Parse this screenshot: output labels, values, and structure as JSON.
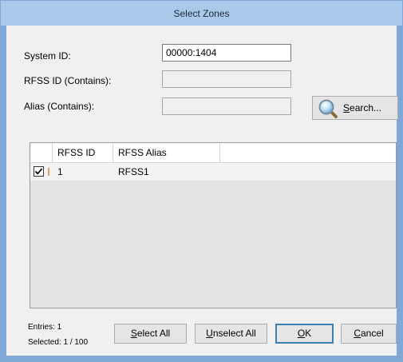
{
  "window": {
    "title": "Select Zones"
  },
  "form": {
    "system_id_label": "System ID:",
    "system_id_value": "00000:1404",
    "rfss_id_label": "RFSS ID (Contains):",
    "rfss_id_value": "",
    "alias_label": "Alias (Contains):",
    "alias_value": "",
    "search_label_underlined": "S",
    "search_label_rest": "earch..."
  },
  "grid": {
    "columns": [
      "RFSS ID",
      "RFSS Alias"
    ],
    "rows": [
      {
        "checked": true,
        "rfss_id": "1",
        "rfss_alias": "RFSS1"
      }
    ]
  },
  "footer": {
    "entries": "Entries: 1",
    "selected": "Selected: 1 / 100",
    "select_all_u": "S",
    "select_all_rest": "elect All",
    "unselect_all_u": "U",
    "unselect_all_rest": "nselect All",
    "ok_u": "O",
    "ok_rest": "K",
    "cancel_u": "C",
    "cancel_rest": "ancel"
  },
  "colors": {
    "window_border": "#7fa8d6",
    "titlebar": "#a9c8ea",
    "client_bg": "#f0f0f0",
    "default_button_border": "#3c7fb1"
  },
  "icons": {
    "search_button_icon": "magnifier-icon",
    "row_check_icon": "checkmark-icon"
  }
}
